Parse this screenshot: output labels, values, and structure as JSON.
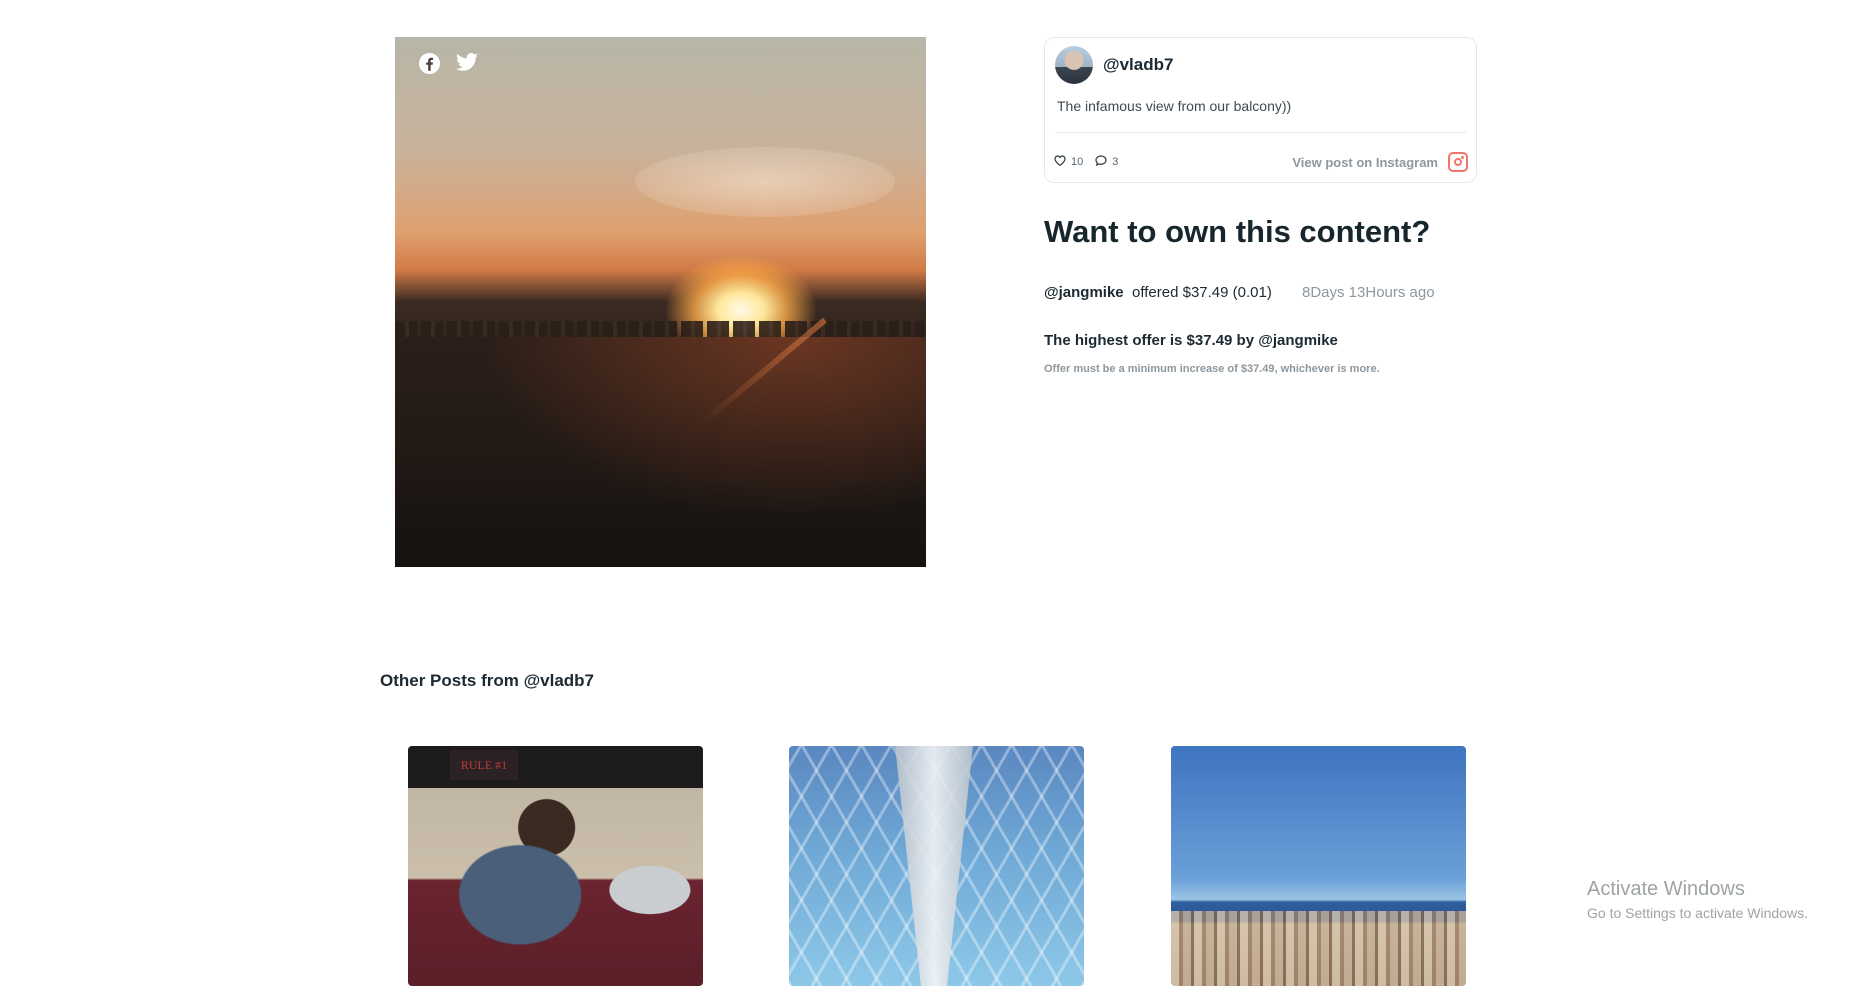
{
  "post": {
    "share_icons": [
      "facebook-icon",
      "twitter-icon"
    ]
  },
  "instagram_card": {
    "username": "@vladb7",
    "caption": "The infamous view from our balcony))",
    "likes": "10",
    "comments": "3",
    "view_link": "View post on Instagram"
  },
  "offer": {
    "title": "Want to own this content?",
    "bidder": "@jangmike",
    "offered_text": "offered $37.49 (0.01)",
    "time_ago": "8Days 13Hours ago",
    "highest": "The highest offer is $37.49 by @jangmike",
    "minimum_note": "Offer must be a minimum increase of $37.49, whichever is more."
  },
  "other_posts": {
    "title": "Other Posts from @vladb7",
    "thumb1_poster": "RULE #1"
  },
  "watermark": {
    "line1": "Activate Windows",
    "line2": "Go to Settings to activate Windows."
  },
  "colors": {
    "text": "#1c2a33",
    "muted": "#8d979e",
    "instagram_accent": "#f1766a"
  }
}
